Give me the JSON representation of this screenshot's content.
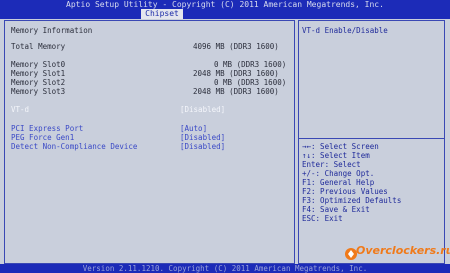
{
  "title": "Aptio Setup Utility - Copyright (C) 2011 American Megatrends, Inc.",
  "tab": "Chipset",
  "left": {
    "memory_info": "Memory Information",
    "total_label": "Total Memory",
    "total_value": "4096 MB (DDR3 1600)",
    "slots": [
      {
        "label": "Memory Slot0",
        "value": "0 MB (DDR3 1600)"
      },
      {
        "label": "Memory Slot1",
        "value": "2048 MB (DDR3 1600)"
      },
      {
        "label": "Memory Slot2",
        "value": "0 MB (DDR3 1600)"
      },
      {
        "label": "Memory Slot3",
        "value": "2048 MB (DDR3 1600)"
      }
    ],
    "vtd_label": "VT-d",
    "vtd_value": "[Disabled]",
    "options": [
      {
        "label": "PCI Express Port",
        "value": "[Auto]"
      },
      {
        "label": "PEG Force Gen1",
        "value": "[Disabled]"
      },
      {
        "label": "Detect Non-Compliance Device",
        "value": "[Disabled]"
      }
    ]
  },
  "right": {
    "help_title": "VT-d Enable/Disable",
    "keys": [
      "→←: Select Screen",
      "↑↓: Select Item",
      "Enter: Select",
      "+/-: Change Opt.",
      "F1: General Help",
      "F2: Previous Values",
      "F3: Optimized Defaults",
      "F4: Save & Exit",
      "ESC: Exit"
    ]
  },
  "footer": "Version 2.11.1210. Copyright (C) 2011 American Megatrends, Inc.",
  "watermark": "Overclockers.ru"
}
